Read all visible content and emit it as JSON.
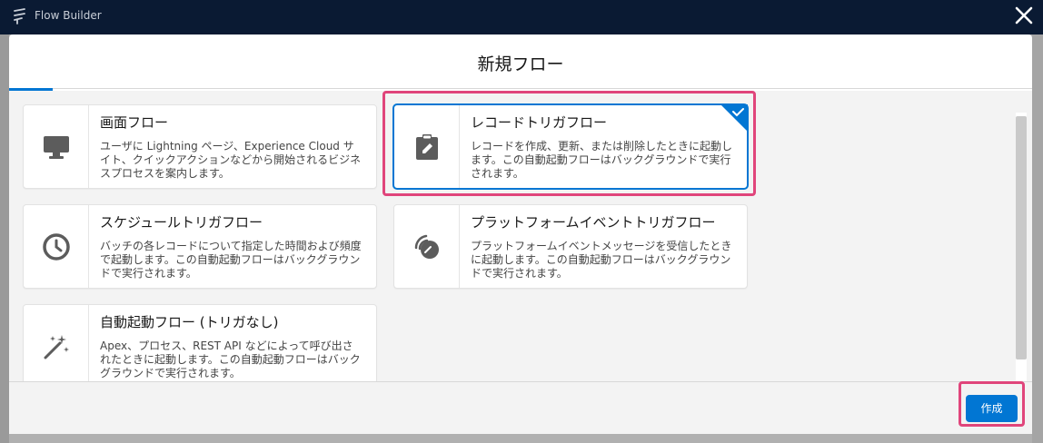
{
  "app": {
    "title": "Flow Builder"
  },
  "modal": {
    "title": "新規フロー"
  },
  "cards": [
    {
      "id": "screen-flow",
      "title": "画面フロー",
      "desc": "ユーザに Lightning ページ、Experience Cloud サイト、クイックアクションなどから開始されるビジネスプロセスを案内します。",
      "icon": "monitor-icon",
      "selected": false
    },
    {
      "id": "record-triggered-flow",
      "title": "レコードトリガフロー",
      "desc": "レコードを作成、更新、または削除したときに起動します。この自動起動フローはバックグラウンドで実行されます。",
      "icon": "clipboard-edit-icon",
      "selected": true
    },
    {
      "id": "schedule-triggered-flow",
      "title": "スケジュールトリガフロー",
      "desc": "バッチの各レコードについて指定した時間および頻度で起動します。この自動起動フローはバックグラウンドで実行されます。",
      "icon": "clock-icon",
      "selected": false
    },
    {
      "id": "platform-event-triggered-flow",
      "title": "プラットフォームイベントトリガフロー",
      "desc": "プラットフォームイベントメッセージを受信したときに起動します。この自動起動フローはバックグラウンドで実行されます。",
      "icon": "signal-icon",
      "selected": false
    },
    {
      "id": "autolaunched-flow",
      "title": "自動起動フロー (トリガなし)",
      "desc": "Apex、プロセス、REST API などによって呼び出されたときに起動します。この自動起動フローはバックグラウンドで実行されます。",
      "icon": "magic-wand-icon",
      "selected": false
    }
  ],
  "footer": {
    "create_label": "作成"
  },
  "colors": {
    "brand": "#0176d3",
    "highlight": "#e0457b",
    "appbar": "#0a1a33"
  }
}
